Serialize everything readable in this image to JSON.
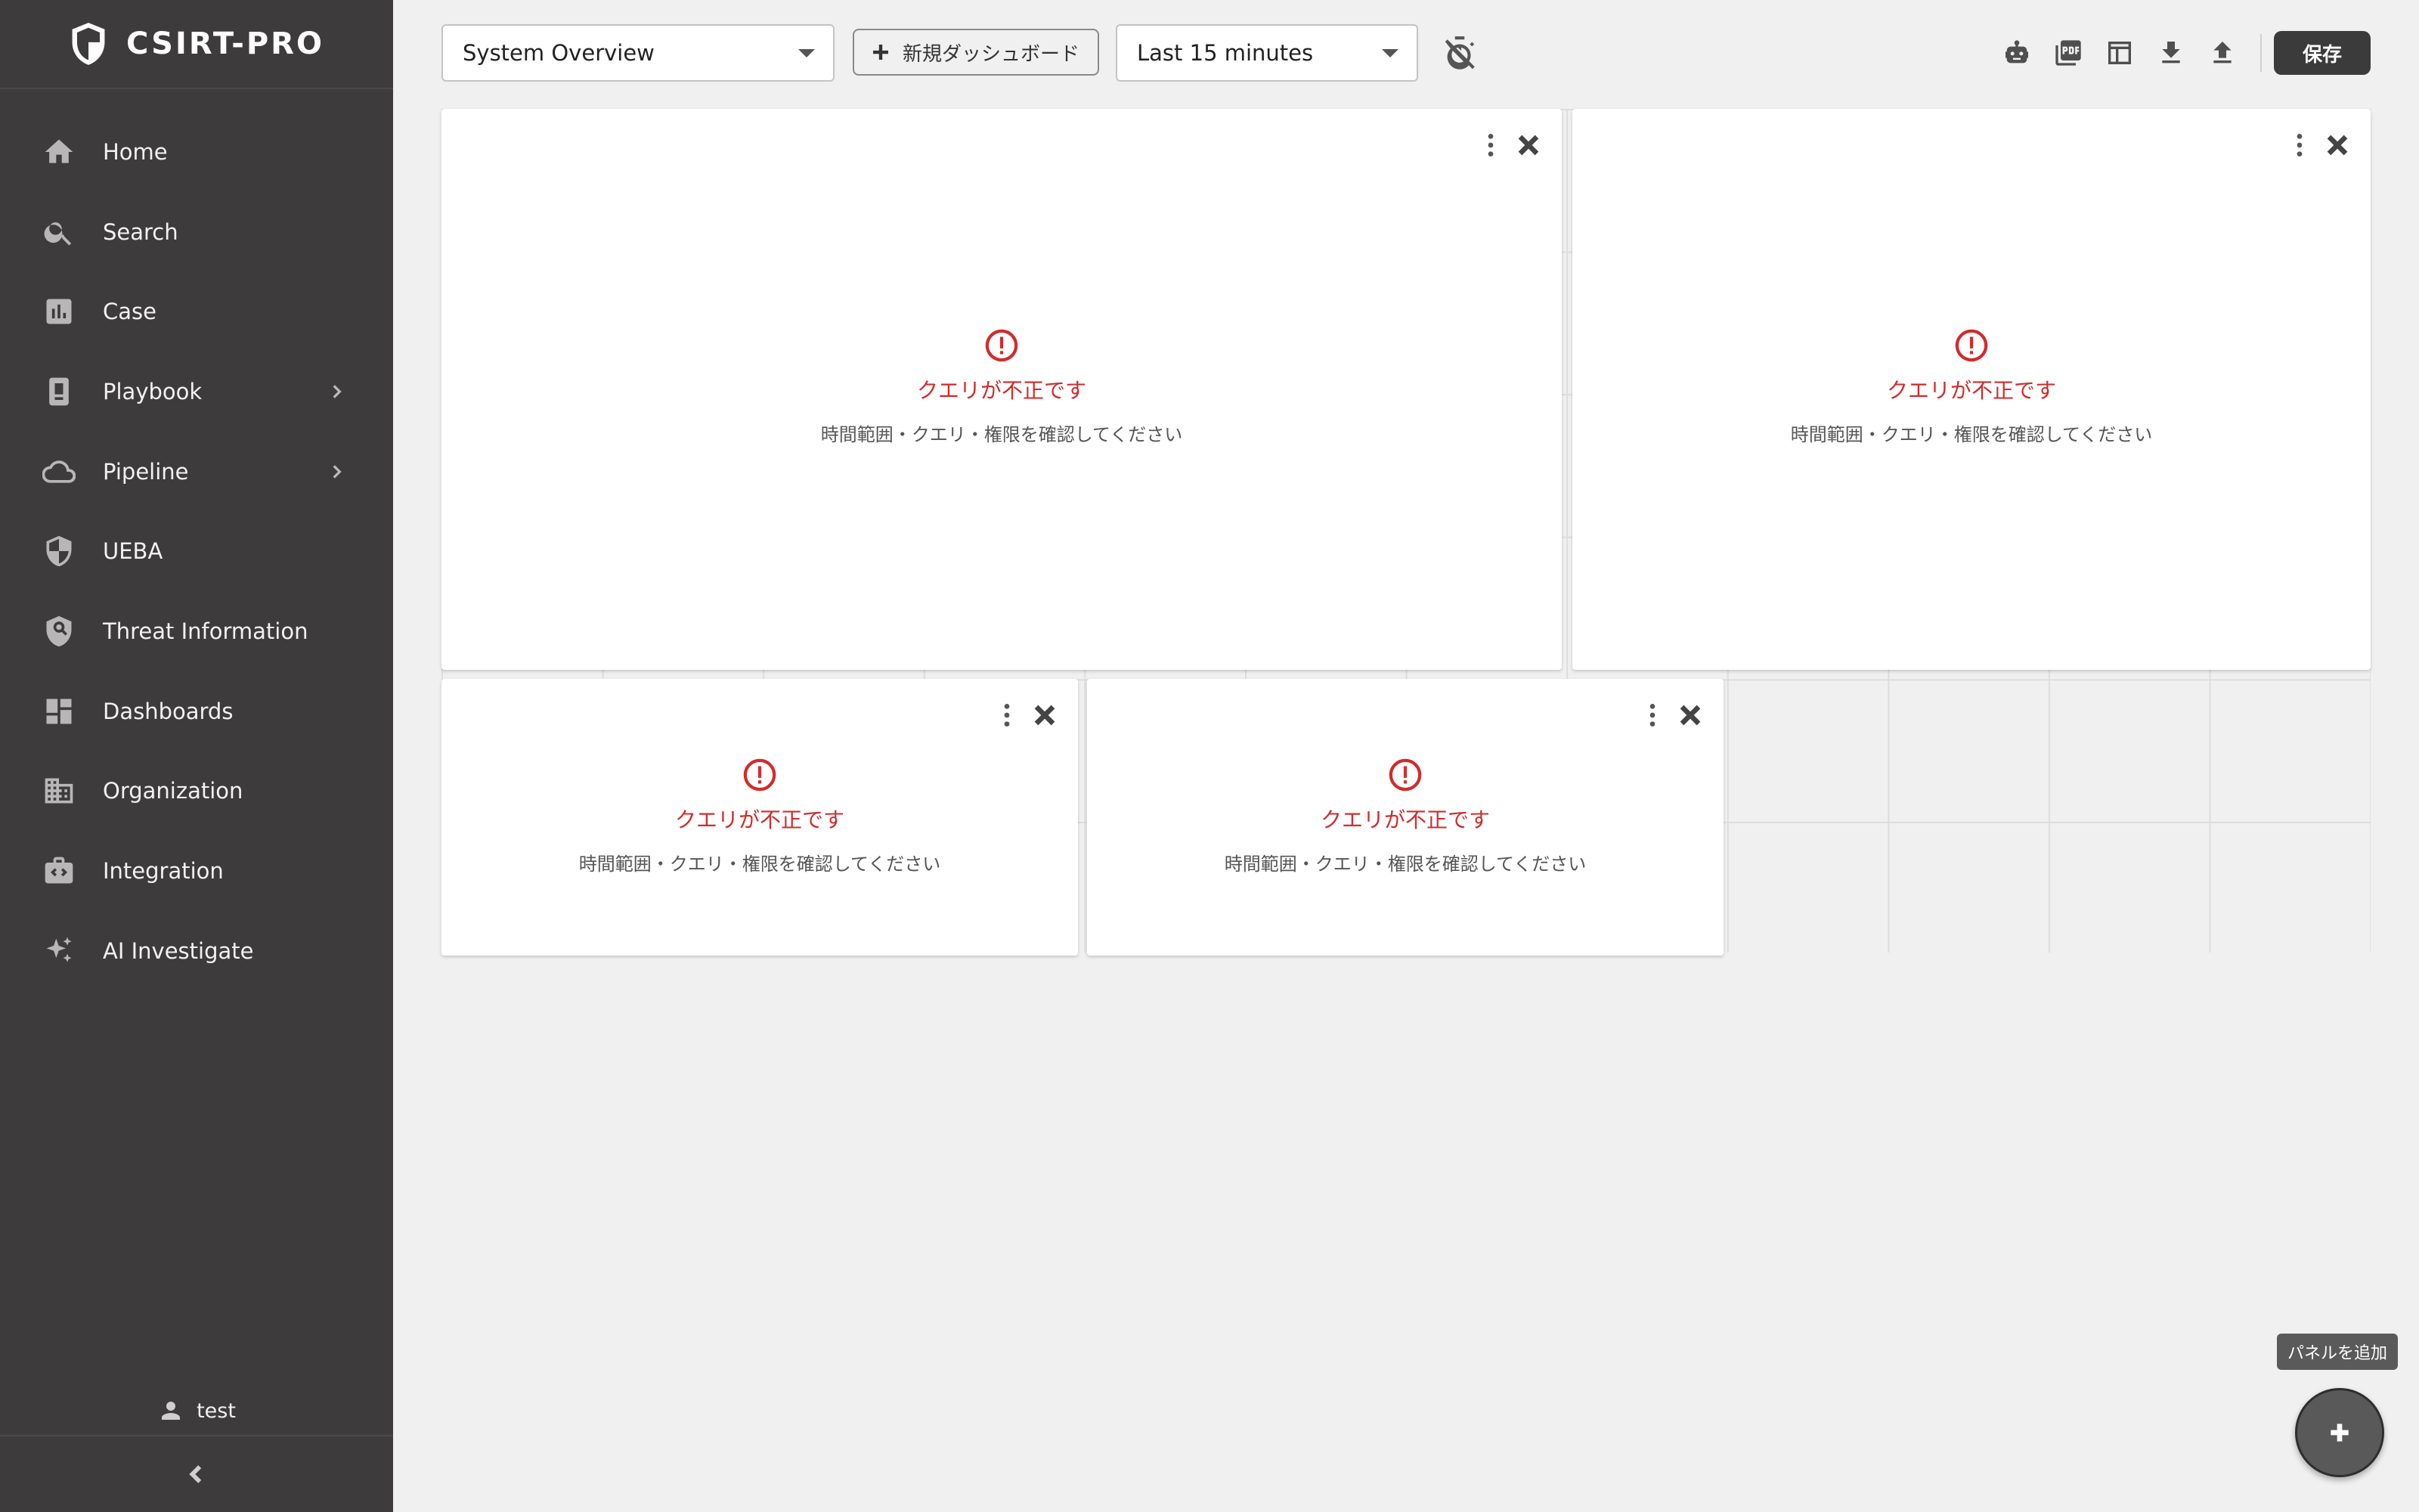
{
  "app": {
    "brand": "CSIRT-PRO"
  },
  "sidebar": {
    "items": [
      {
        "label": "Home",
        "icon": "home-icon",
        "has_submenu": false
      },
      {
        "label": "Search",
        "icon": "search-icon",
        "has_submenu": false
      },
      {
        "label": "Case",
        "icon": "bar-chart-icon",
        "has_submenu": false
      },
      {
        "label": "Playbook",
        "icon": "book-icon",
        "has_submenu": true
      },
      {
        "label": "Pipeline",
        "icon": "cloud-icon",
        "has_submenu": true
      },
      {
        "label": "UEBA",
        "icon": "shield-half-icon",
        "has_submenu": false
      },
      {
        "label": "Threat Information",
        "icon": "shield-search-icon",
        "has_submenu": false
      },
      {
        "label": "Dashboards",
        "icon": "dashboard-icon",
        "has_submenu": false
      },
      {
        "label": "Organization",
        "icon": "building-icon",
        "has_submenu": false
      },
      {
        "label": "Integration",
        "icon": "integration-icon",
        "has_submenu": false
      },
      {
        "label": "AI Investigate",
        "icon": "sparkle-icon",
        "has_submenu": false
      }
    ],
    "user": "test"
  },
  "toolbar": {
    "dashboard_select": "System Overview",
    "new_dashboard_label": "新規ダッシュボード",
    "time_range": "Last 15 minutes",
    "save_label": "保存",
    "tools": [
      "robot-icon",
      "pdf-icon",
      "table-icon",
      "download-icon",
      "upload-icon",
      "timer-off-icon"
    ]
  },
  "panels": [
    {
      "error_title": "クエリが不正です",
      "error_message": "時間範囲・クエリ・権限を確認してください"
    },
    {
      "error_title": "クエリが不正です",
      "error_message": "時間範囲・クエリ・権限を確認してください"
    },
    {
      "error_title": "クエリが不正です",
      "error_message": "時間範囲・クエリ・権限を確認してください"
    },
    {
      "error_title": "クエリが不正です",
      "error_message": "時間範囲・クエリ・権限を確認してください"
    }
  ],
  "fab": {
    "tooltip": "パネルを追加"
  },
  "colors": {
    "sidebar_bg": "#3d3b3b",
    "page_bg": "#f0f0f0",
    "error_red": "#d12c2c",
    "save_button": "#3b3b3b"
  }
}
